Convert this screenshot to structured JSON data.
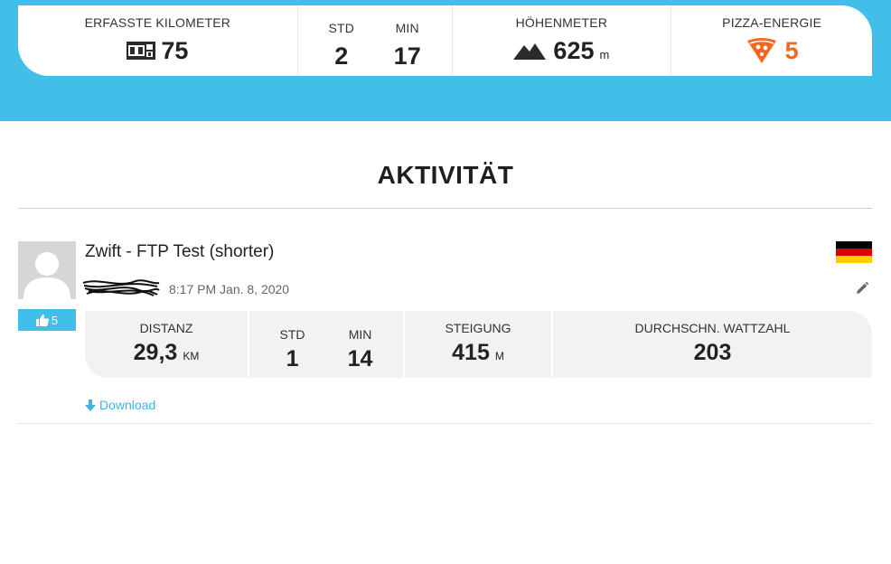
{
  "summary": {
    "km": {
      "label": "ERFASSTE KILOMETER",
      "value": "75"
    },
    "time": {
      "hours_label": "STD",
      "hours_value": "2",
      "minutes_label": "MIN",
      "minutes_value": "17"
    },
    "elevation": {
      "label": "HÖHENMETER",
      "value": "625",
      "unit": "m"
    },
    "pizza": {
      "label": "PIZZA-ENERGIE",
      "value": "5"
    }
  },
  "section": {
    "title": "AKTIVITÄT"
  },
  "activity": {
    "title": "Zwift - FTP Test (shorter)",
    "date": "8:17 PM Jan. 8, 2020",
    "likes": "5",
    "download_label": "Download",
    "stats": {
      "distance": {
        "label": "DISTANZ",
        "value": "29,3",
        "unit": "KM"
      },
      "hours": {
        "label": "STD",
        "value": "1"
      },
      "minutes": {
        "label": "MIN",
        "value": "14"
      },
      "climb": {
        "label": "STEIGUNG",
        "value": "415",
        "unit": "M"
      },
      "watts": {
        "label": "DURCHSCHN. WATTZAHL",
        "value": "203"
      }
    }
  },
  "colors": {
    "accent": "#41bfe8",
    "pizza": "#f26722",
    "flag": [
      "#000000",
      "#dd0000",
      "#ffce00"
    ]
  },
  "icons": {
    "odometer": "odometer-icon",
    "mountain": "mountain-icon",
    "pizza": "pizza-icon",
    "thumbs_up": "thumbs-up-icon",
    "edit": "pencil-icon",
    "download": "arrow-down-icon",
    "avatar": "user-avatar-icon",
    "flag": "germany-flag-icon"
  }
}
